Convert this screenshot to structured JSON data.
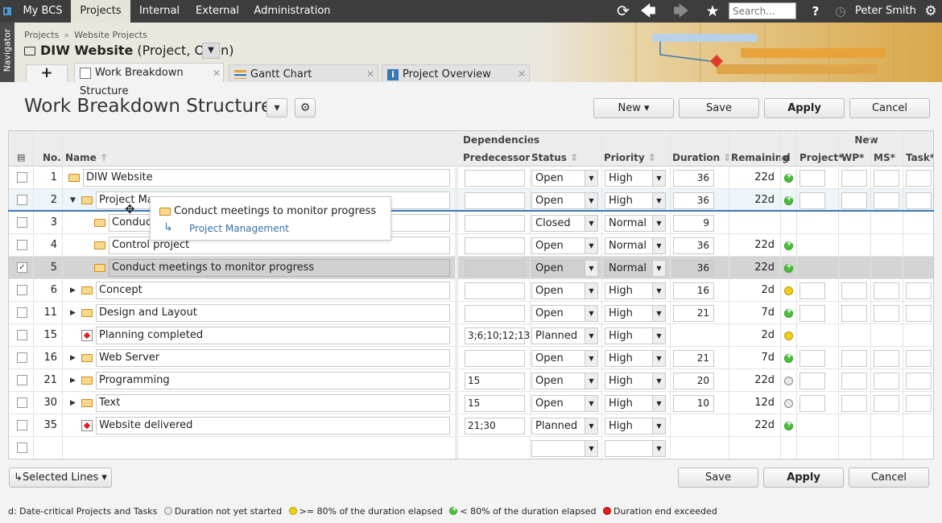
{
  "topbar": {
    "menu": [
      "My BCS",
      "Projects",
      "Internal",
      "External",
      "Administration"
    ],
    "active_menu": "Projects",
    "search_placeholder": "Search...",
    "user": "Peter Smith",
    "help": "?"
  },
  "navigator_label": "Navigator",
  "breadcrumb": [
    "Projects",
    "Website Projects"
  ],
  "breadcrumb_sep": "»",
  "project": {
    "name": "DIW Website",
    "subtitle": "(Project, Open)"
  },
  "tabs": [
    {
      "label": "Work Breakdown Structure",
      "icon": "hierarchy-icon",
      "active": true
    },
    {
      "label": "Gantt Chart",
      "icon": "gantt-icon",
      "active": false
    },
    {
      "label": "Project Overview",
      "icon": "info-icon",
      "active": false
    }
  ],
  "page_title": "Work Breakdown Structure",
  "buttons": {
    "new": "New",
    "save": "Save",
    "apply": "Apply",
    "cancel": "Cancel",
    "selected_lines": "Selected Lines"
  },
  "grid": {
    "groups": {
      "dependencies": "Dependencies",
      "new": "New"
    },
    "headers": {
      "no": "No.",
      "name": "Name",
      "predecessor": "Predecessor",
      "status": "Status",
      "priority": "Priority",
      "duration": "Duration",
      "remaining": "Remaining",
      "d": "d",
      "project": "Project*",
      "wp": "WP*",
      "ms": "MS*",
      "task": "Task*"
    },
    "rows": [
      {
        "no": "1",
        "name": "DIW Website",
        "level": 0,
        "type": "folder",
        "pred": "",
        "status": "Open",
        "priority": "High",
        "duration": "36",
        "remaining": "22d",
        "d": "green",
        "new": true
      },
      {
        "no": "2",
        "name": "Project Ma",
        "level": 1,
        "type": "folder",
        "expanded": true,
        "pred": "",
        "status": "Open",
        "priority": "High",
        "duration": "36",
        "remaining": "22d",
        "d": "green",
        "new": true
      },
      {
        "no": "3",
        "name": "Conduct",
        "level": 2,
        "type": "folder",
        "pred": "",
        "status": "Closed",
        "priority": "Normal",
        "duration": "9",
        "remaining": "",
        "d": "",
        "new": false
      },
      {
        "no": "4",
        "name": "Control project",
        "level": 2,
        "type": "folder",
        "pred": "",
        "status": "Open",
        "priority": "Normal",
        "duration": "36",
        "remaining": "22d",
        "d": "green",
        "new": false
      },
      {
        "no": "5",
        "name": "Conduct meetings to monitor progress",
        "level": 2,
        "type": "folder",
        "pred": "",
        "status": "Open",
        "priority": "Normal",
        "duration": "36",
        "remaining": "22d",
        "d": "green",
        "new": false,
        "checked": true
      },
      {
        "no": "6",
        "name": "Concept",
        "level": 1,
        "type": "folder",
        "collapsed": true,
        "pred": "",
        "status": "Open",
        "priority": "High",
        "duration": "16",
        "remaining": "2d",
        "d": "yellow",
        "new": true
      },
      {
        "no": "11",
        "name": "Design and Layout",
        "level": 1,
        "type": "folder",
        "collapsed": true,
        "pred": "",
        "status": "Open",
        "priority": "High",
        "duration": "21",
        "remaining": "7d",
        "d": "green",
        "new": true
      },
      {
        "no": "15",
        "name": "Planning completed",
        "level": 1,
        "type": "milestone",
        "pred": "3;6;10;12;13",
        "status": "Planned",
        "priority": "High",
        "duration": "",
        "remaining": "2d",
        "d": "yellow",
        "new": false
      },
      {
        "no": "16",
        "name": "Web Server",
        "level": 1,
        "type": "folder",
        "collapsed": true,
        "pred": "",
        "status": "Open",
        "priority": "High",
        "duration": "21",
        "remaining": "7d",
        "d": "green",
        "new": true
      },
      {
        "no": "21",
        "name": "Programming",
        "level": 1,
        "type": "folder",
        "collapsed": true,
        "pred": "15",
        "status": "Open",
        "priority": "High",
        "duration": "20",
        "remaining": "22d",
        "d": "grey",
        "new": true
      },
      {
        "no": "30",
        "name": "Text",
        "level": 1,
        "type": "folder",
        "collapsed": true,
        "pred": "15",
        "status": "Open",
        "priority": "High",
        "duration": "10",
        "remaining": "12d",
        "d": "grey",
        "new": true
      },
      {
        "no": "35",
        "name": "Website delivered",
        "level": 1,
        "type": "milestone",
        "pred": "21;30",
        "status": "Planned",
        "priority": "High",
        "duration": "",
        "remaining": "22d",
        "d": "green",
        "new": false
      }
    ]
  },
  "drag_tooltip": {
    "title": "Conduct meetings to monitor progress",
    "target": "Project Management"
  },
  "legend": {
    "intro": "d: Date-critical Projects and Tasks",
    "items": [
      {
        "color": "grey",
        "label": "Duration not yet started"
      },
      {
        "color": "yellow",
        "label": ">= 80% of the duration elapsed"
      },
      {
        "color": "green",
        "label": "< 80% of the duration elapsed"
      },
      {
        "color": "red",
        "label": "Duration end exceeded"
      }
    ]
  },
  "colors": {
    "topbar": "#3d3d3d",
    "accent": "#3a78b5",
    "header_bg": "#eae7de"
  }
}
